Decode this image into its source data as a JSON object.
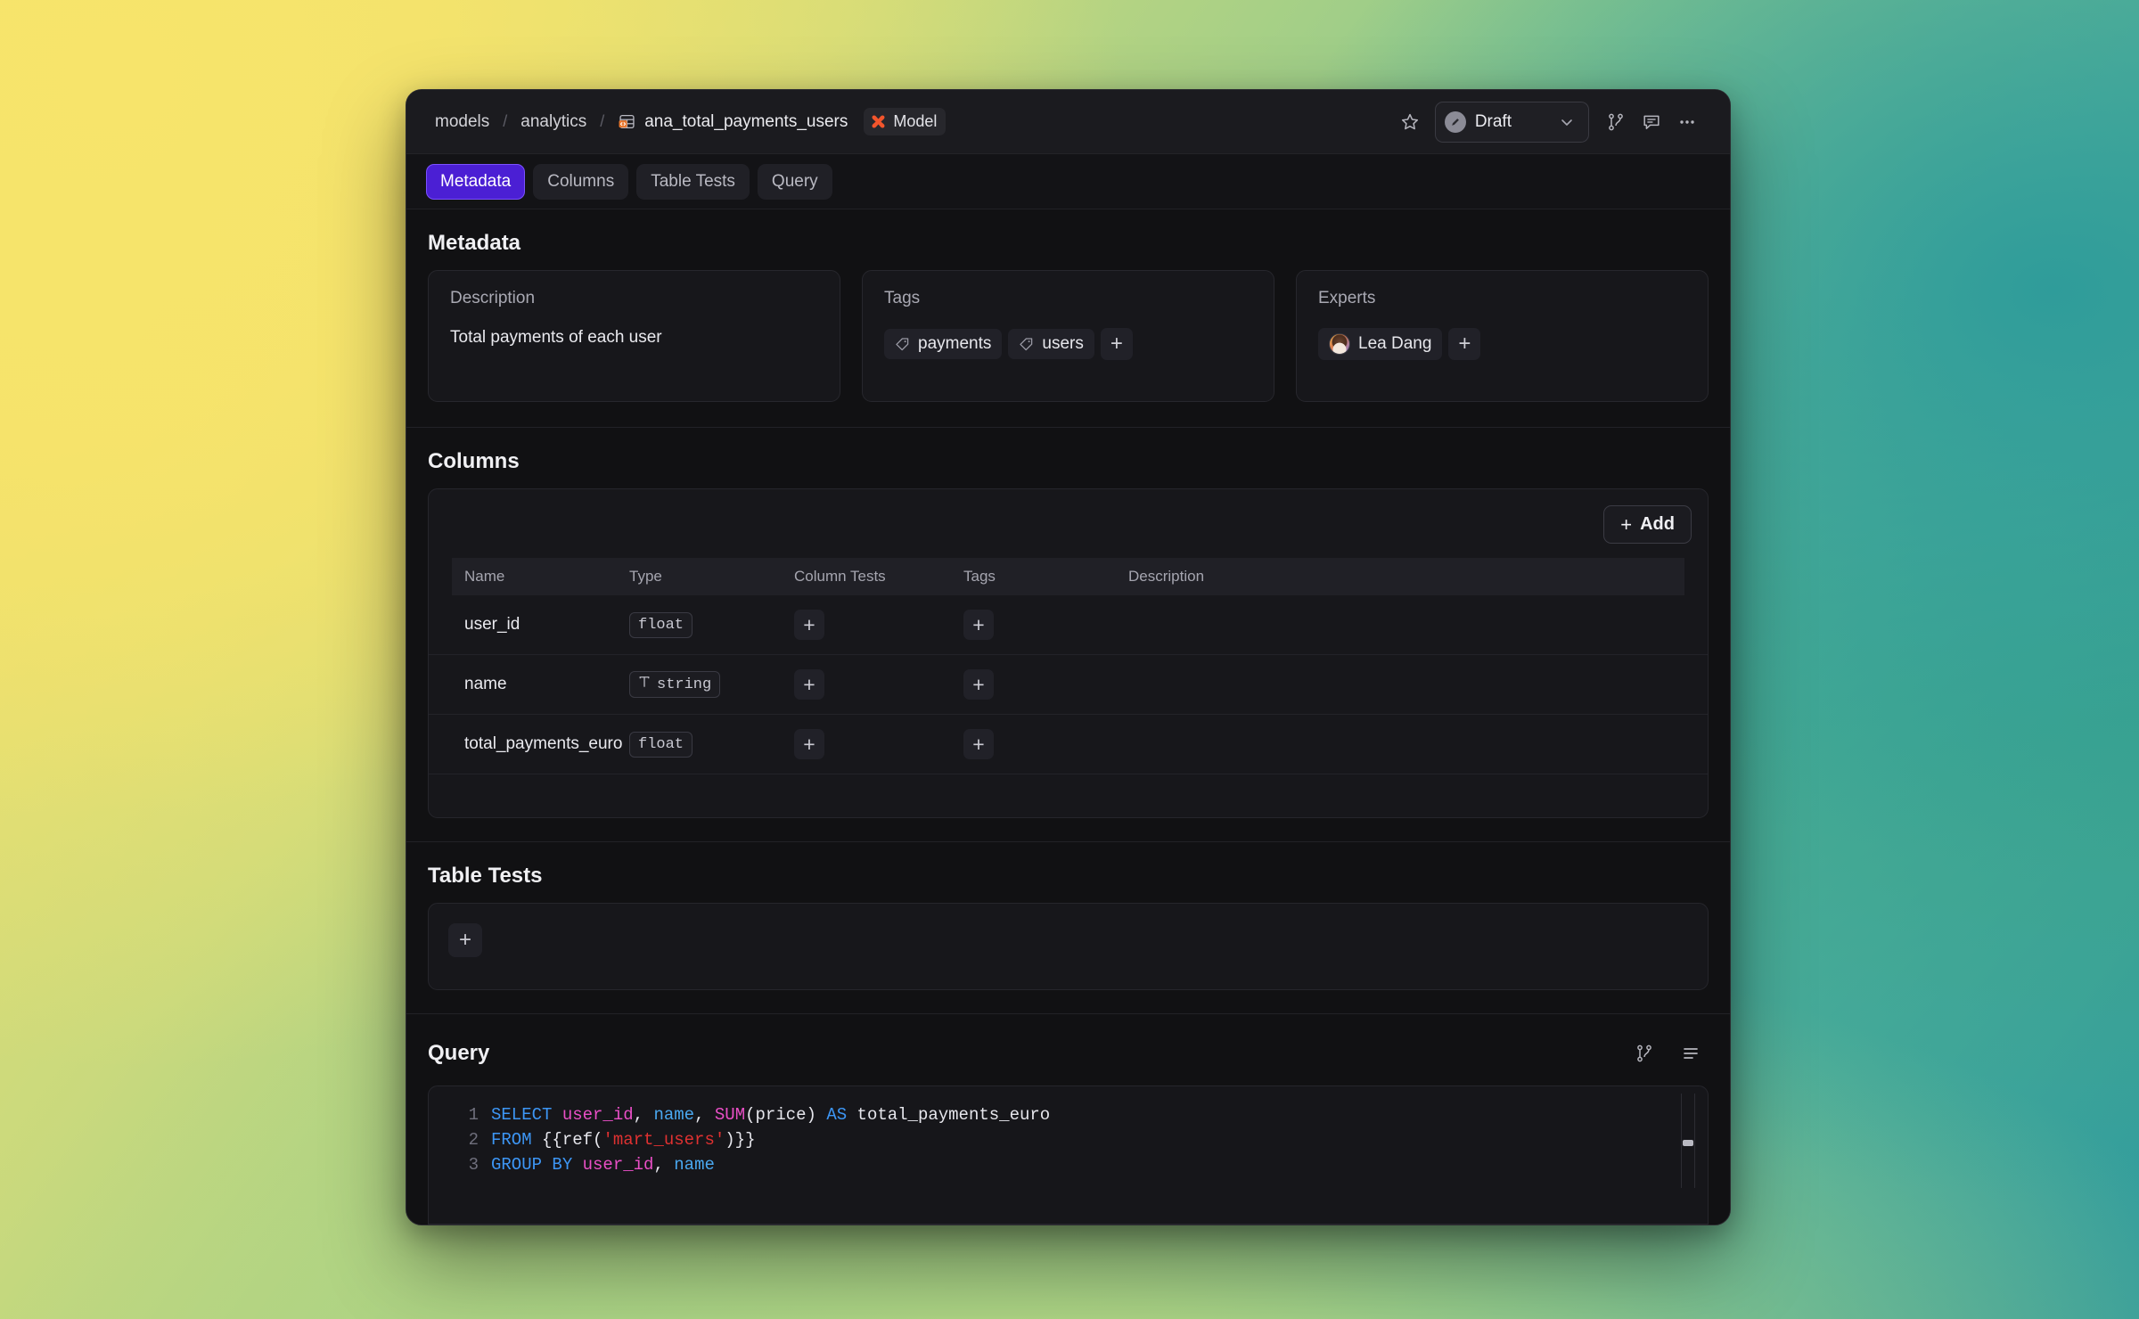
{
  "titlebar": {
    "breadcrumb": [
      "models",
      "analytics"
    ],
    "separator": "/",
    "file_name": "ana_total_payments_users",
    "file_icon": "table-code-icon",
    "model_chip": {
      "label": "Model",
      "icon": "dbt-x-icon"
    },
    "star_icon": "star-icon",
    "status": {
      "label": "Draft",
      "icon": "pencil-icon",
      "caret": "chevron-down-icon"
    },
    "branch_icon": "git-branch-icon",
    "comment_icon": "comment-icon",
    "more_icon": "ellipsis-icon"
  },
  "tabs": [
    {
      "label": "Metadata",
      "active": true
    },
    {
      "label": "Columns",
      "active": false
    },
    {
      "label": "Table Tests",
      "active": false
    },
    {
      "label": "Query",
      "active": false
    }
  ],
  "metadata": {
    "heading": "Metadata",
    "description": {
      "label": "Description",
      "value": "Total payments of each user"
    },
    "tags": {
      "label": "Tags",
      "items": [
        "payments",
        "users"
      ],
      "add": "+"
    },
    "experts": {
      "label": "Experts",
      "items": [
        "Lea Dang"
      ],
      "add": "+"
    }
  },
  "columns": {
    "heading": "Columns",
    "add_button": {
      "plus": "+",
      "label": "Add"
    },
    "headers": [
      "Name",
      "Type",
      "Column Tests",
      "Tags",
      "Description"
    ],
    "rows": [
      {
        "name": "user_id",
        "type": "float",
        "type_icon": "",
        "tests_add": "+",
        "tags_add": "+",
        "description": ""
      },
      {
        "name": "name",
        "type": "string",
        "type_icon": "text-type-icon",
        "tests_add": "+",
        "tags_add": "+",
        "description": ""
      },
      {
        "name": "total_payments_euro",
        "type": "float",
        "type_icon": "",
        "tests_add": "+",
        "tags_add": "+",
        "description": ""
      }
    ]
  },
  "table_tests": {
    "heading": "Table Tests",
    "add": "+"
  },
  "query": {
    "heading": "Query",
    "branch_icon": "git-branch-icon",
    "format_icon": "format-lines-icon",
    "lines": [
      {
        "n": "1",
        "tokens": [
          {
            "t": "SELECT",
            "c": "k"
          },
          {
            "t": " ",
            "c": "pl"
          },
          {
            "t": "user_id",
            "c": "id"
          },
          {
            "t": ", ",
            "c": "pl"
          },
          {
            "t": "name",
            "c": "cy"
          },
          {
            "t": ", ",
            "c": "pl"
          },
          {
            "t": "SUM",
            "c": "fn"
          },
          {
            "t": "(price) ",
            "c": "pl"
          },
          {
            "t": "AS",
            "c": "k"
          },
          {
            "t": " total_payments_euro",
            "c": "pl"
          }
        ]
      },
      {
        "n": "2",
        "tokens": [
          {
            "t": "FROM",
            "c": "k"
          },
          {
            "t": " {{ref(",
            "c": "pl"
          },
          {
            "t": "'mart_users'",
            "c": "st"
          },
          {
            "t": ")}}",
            "c": "pl"
          }
        ]
      },
      {
        "n": "3",
        "tokens": [
          {
            "t": "GROUP BY",
            "c": "k"
          },
          {
            "t": " ",
            "c": "pl"
          },
          {
            "t": "user_id",
            "c": "id"
          },
          {
            "t": ", ",
            "c": "pl"
          },
          {
            "t": "name",
            "c": "cy"
          }
        ]
      }
    ]
  },
  "colors": {
    "accent_purple": "#4b1fd4",
    "accent_orange": "#f06c3a",
    "keyword_blue": "#3d96f5",
    "identifier_magenta": "#ea4fc7",
    "string_red": "#e03131",
    "window_bg": "#121214",
    "panel_bg": "#17171b"
  }
}
